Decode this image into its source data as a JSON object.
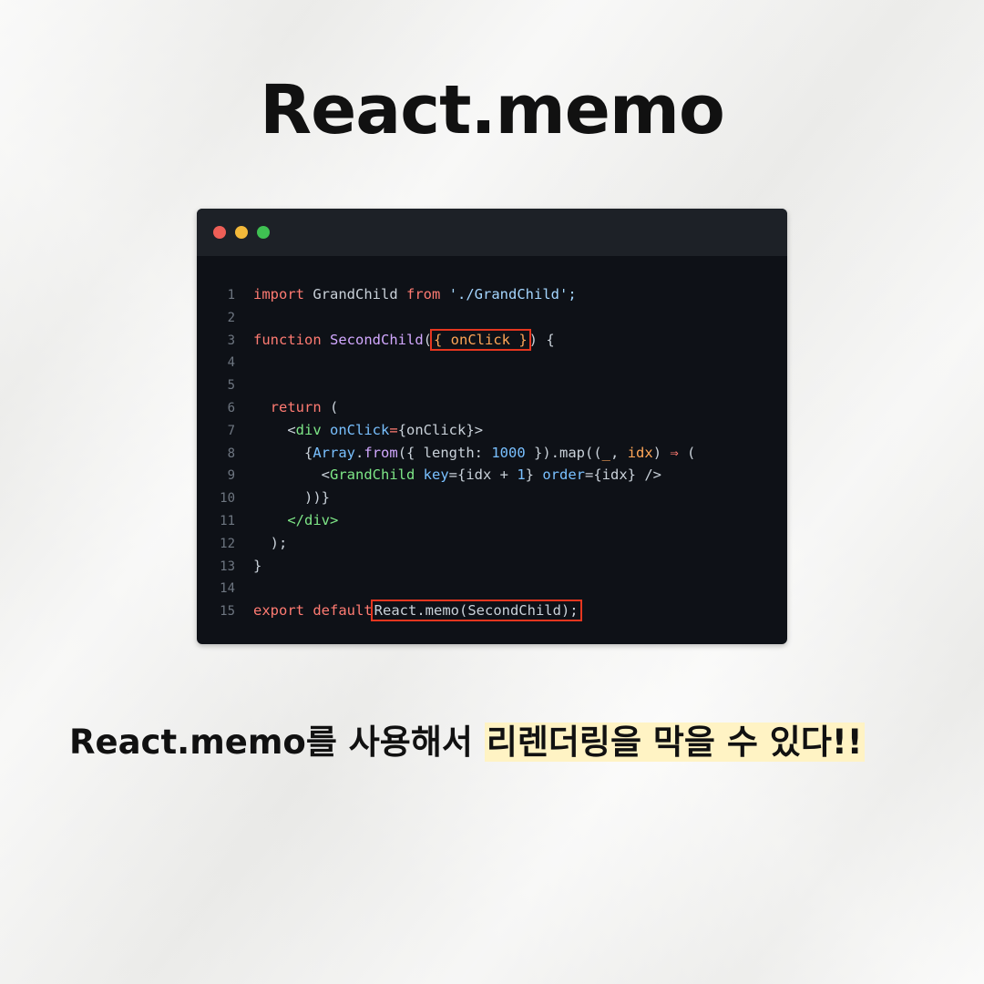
{
  "title": "React.memo",
  "window": {
    "dots": [
      "red",
      "yellow",
      "green"
    ],
    "colors": {
      "red": "#ee5f57",
      "yellow": "#f3b93a",
      "green": "#3fc152"
    }
  },
  "code": {
    "line_numbers": [
      "1",
      "2",
      "3",
      "4",
      "5",
      "6",
      "7",
      "8",
      "9",
      "10",
      "11",
      "12",
      "13",
      "14",
      "15"
    ],
    "l1": {
      "import": "import",
      "name": "GrandChild",
      "from": "from",
      "path": "'./GrandChild';"
    },
    "l3": {
      "function": "function",
      "name": "SecondChild",
      "open": "(",
      "params": "{ onClick }",
      "close": ") {"
    },
    "l6": {
      "return": "return",
      "paren": "("
    },
    "l7": {
      "open": "<",
      "tag": "div",
      "attr": "onClick",
      "eq": "=",
      "value": "{onClick}",
      "close": ">"
    },
    "l8": {
      "brace": "{",
      "array": "Array",
      "dot": ".",
      "from": "from",
      "args1": "({ length: ",
      "num": "1000",
      "args2": " }).map((",
      "p1": "_",
      "comma": ", ",
      "p2": "idx",
      "close": ") ",
      "arrow": "⇒",
      "open": " ("
    },
    "l9": {
      "open": "<",
      "tag": "GrandChild",
      "key": "key",
      "keyval": "={idx + ",
      "one": "1",
      "keyend": "} ",
      "order": "order",
      "orderval": "={idx} ",
      "selfclose": "/>"
    },
    "l10": {
      "text": "))}"
    },
    "l11": {
      "text": "</div>"
    },
    "l12": {
      "text": ");"
    },
    "l13": {
      "text": "}"
    },
    "l15": {
      "export": "export",
      "default": "default",
      "memo": "React.memo(SecondChild);"
    }
  },
  "caption": {
    "lead": "React.memo를 사용해서 ",
    "highlight": "리렌더링을 막을 수 있다!!"
  }
}
